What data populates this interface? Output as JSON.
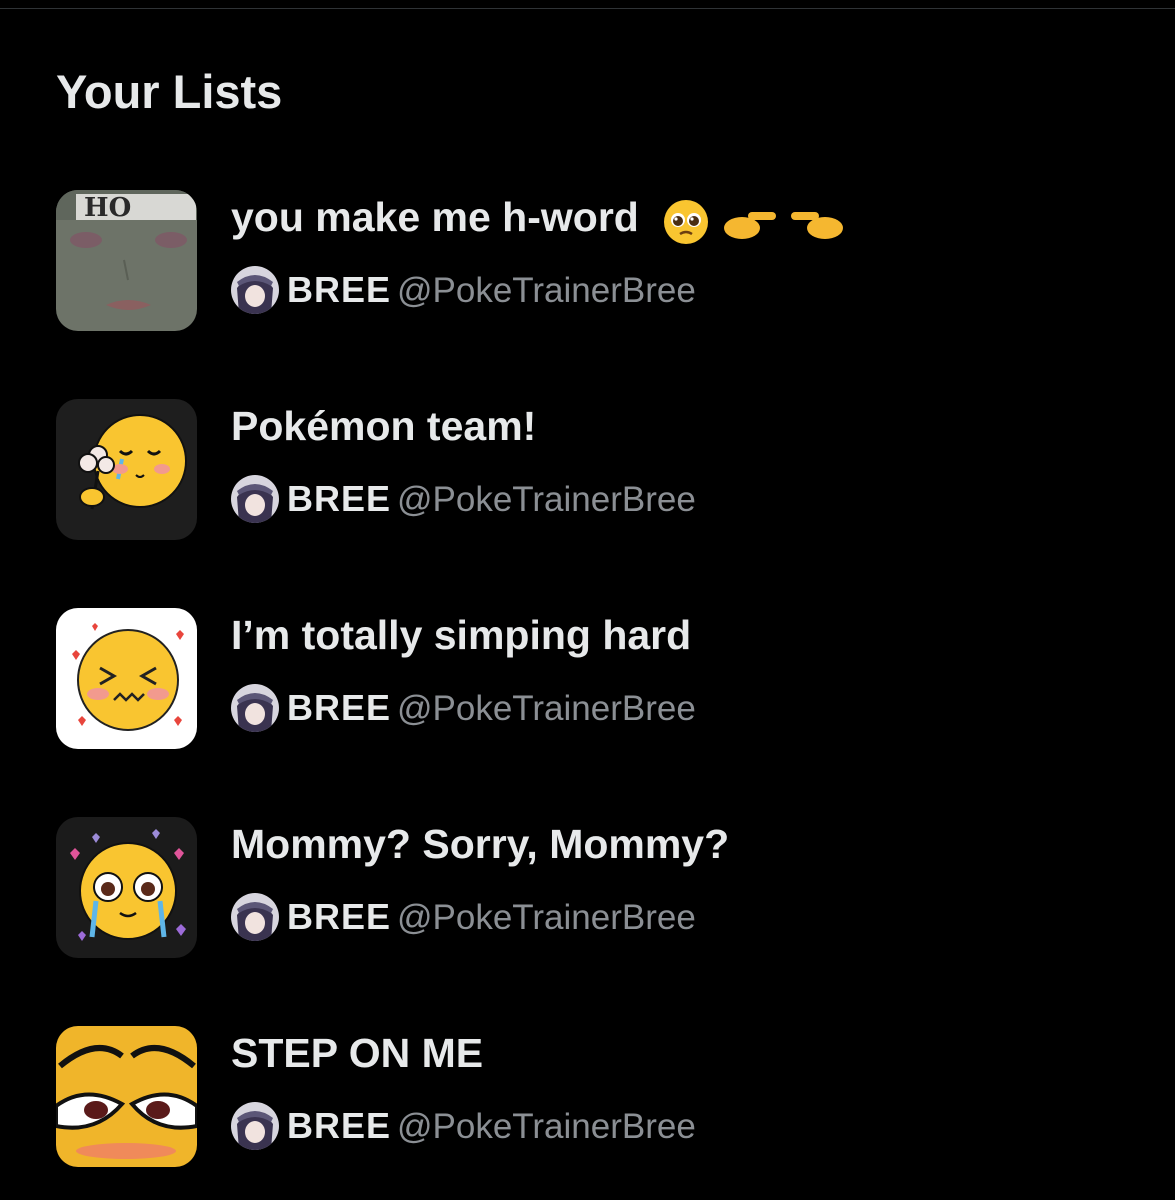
{
  "section": {
    "title": "Your Lists"
  },
  "lists": [
    {
      "name": "you make me h-word",
      "emojis": [
        "pleading-face-icon",
        "pointing-right-icon",
        "pointing-left-icon"
      ],
      "owner_name": "BREE",
      "owner_handle": "@PokeTrainerBree",
      "thumb": "ho-face-thumbnail"
    },
    {
      "name": "Pokémon team!",
      "owner_name": "BREE",
      "owner_handle": "@PokeTrainerBree",
      "thumb": "crying-flower-emoji-thumbnail"
    },
    {
      "name": "I’m totally simping hard",
      "owner_name": "BREE",
      "owner_handle": "@PokeTrainerBree",
      "thumb": "flustered-hearts-emoji-thumbnail"
    },
    {
      "name": "Mommy? Sorry, Mommy?",
      "owner_name": "BREE",
      "owner_handle": "@PokeTrainerBree",
      "thumb": "teary-hearts-emoji-thumbnail"
    },
    {
      "name": "STEP ON ME",
      "owner_name": "BREE",
      "owner_handle": "@PokeTrainerBree",
      "thumb": "smug-eyes-emoji-thumbnail"
    }
  ],
  "colors": {
    "background": "#000000",
    "text": "#e7e9ea",
    "secondary": "#8b8f94",
    "emoji_yellow": "#f9c530"
  }
}
